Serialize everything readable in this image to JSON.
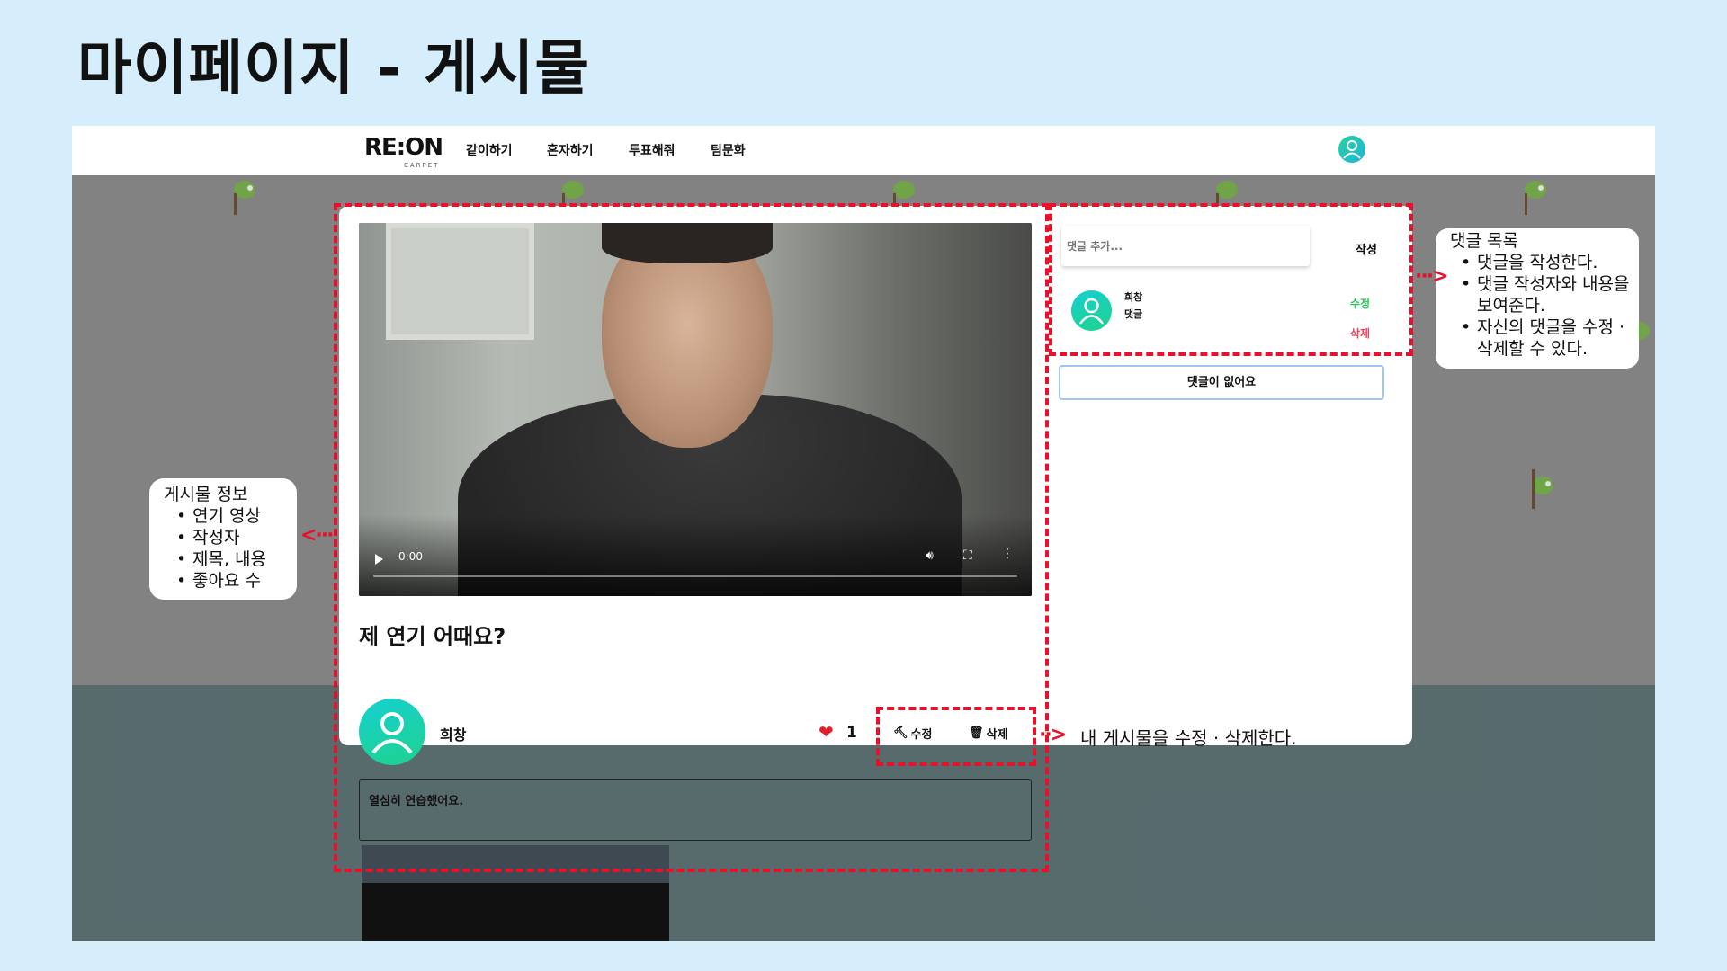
{
  "slide": {
    "title": "마이페이지 - 게시물"
  },
  "nav": {
    "logo": "RE:ON",
    "logo_sub": "CARPET",
    "items": [
      "같이하기",
      "혼자하기",
      "투표해줘",
      "팀문화"
    ]
  },
  "video": {
    "time": "0:00"
  },
  "post": {
    "title": "제 연기 어때요?",
    "author": "희창",
    "likes": "1",
    "edit_label": "수정",
    "delete_label": "삭제",
    "content": "열심히 연습했어요."
  },
  "comments": {
    "placeholder": "댓글 추가...",
    "submit_label": "작성",
    "items": [
      {
        "author": "희창",
        "text": "댓글",
        "edit_label": "수정",
        "delete_label": "삭제"
      }
    ],
    "empty_label": "댓글이 없어요"
  },
  "callouts": {
    "post_info": {
      "title": "게시물 정보",
      "items": [
        "연기 영상",
        "작성자",
        "제목, 내용",
        "좋아요 수"
      ]
    },
    "comments": {
      "title": "댓글 목록",
      "items": [
        "댓글을 작성한다.",
        "댓글 작성자와 내용을 보여준다.",
        "자신의 댓글을 수정 · 삭제할 수 있다."
      ]
    },
    "edit_delete": "내 게시물을 수정 · 삭제한다."
  },
  "colors": {
    "highlight": "#e8102a",
    "background": "#d6eefb",
    "edit_green": "#2ec45e",
    "delete_red": "#e83f5a"
  }
}
